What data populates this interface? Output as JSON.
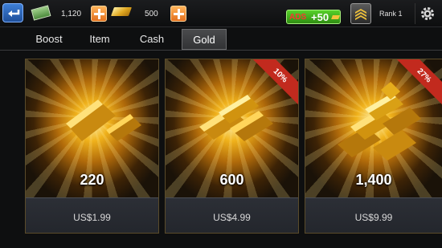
{
  "currencies": {
    "cash": {
      "icon": "cash-icon",
      "value": "1,120"
    },
    "gold": {
      "icon": "gold-bar-icon",
      "value": "500"
    }
  },
  "ads_button": {
    "tag": "ADS",
    "value": "+50"
  },
  "rank": {
    "label": "Rank 1",
    "icon": "rank-chevron-icon"
  },
  "tabs": [
    {
      "label": "Boost",
      "active": false
    },
    {
      "label": "Item",
      "active": false
    },
    {
      "label": "Cash",
      "active": false
    },
    {
      "label": "Gold",
      "active": true
    }
  ],
  "offers": [
    {
      "amount": "220",
      "price": "US$1.99",
      "badge": ""
    },
    {
      "amount": "600",
      "price": "US$4.99",
      "badge": "10%"
    },
    {
      "amount": "1,400",
      "price": "US$9.99",
      "badge": "27%"
    }
  ],
  "colors": {
    "accent_gold": "#f0b21c",
    "badge_red": "#c22a1e",
    "tab_active": "#4a4b4d",
    "ads_green": "#3fae1c"
  }
}
